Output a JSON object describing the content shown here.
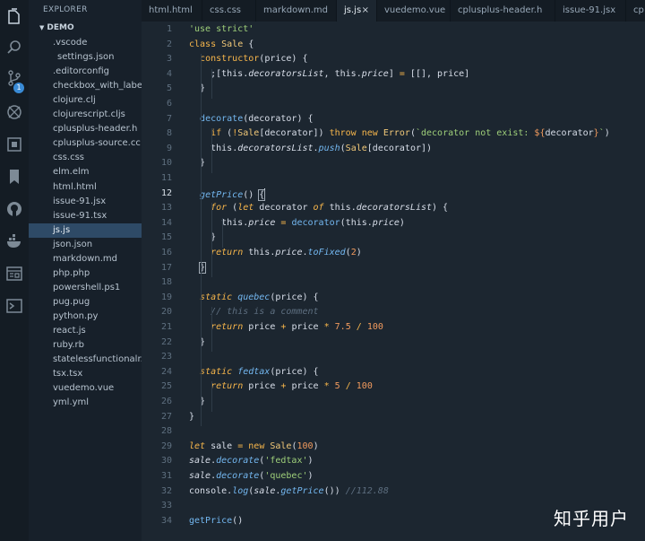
{
  "explorer": {
    "title": "EXPLORER",
    "folder": "DEMO",
    "files": [
      ".vscode",
      "settings.json",
      ".editorconfig",
      "checkbox_with_label...",
      "clojure.clj",
      "clojurescript.cljs",
      "cplusplus-header.h",
      "cplusplus-source.cc",
      "css.css",
      "elm.elm",
      "html.html",
      "issue-91.jsx",
      "issue-91.tsx",
      "js.js",
      "json.json",
      "markdown.md",
      "php.php",
      "powershell.ps1",
      "pug.pug",
      "python.py",
      "react.js",
      "ruby.rb",
      "statelessfunctionalr...",
      "tsx.tsx",
      "vuedemo.vue",
      "yml.yml"
    ]
  },
  "activity": {
    "icons": [
      "files-icon",
      "search-icon",
      "source-control-icon",
      "debug-icon",
      "extensions-icon",
      "bookmark-icon",
      "github-icon",
      "docker-icon",
      "browser-preview-icon",
      "terminal-icon"
    ],
    "scm_badge": "1",
    "color_icon": "#7d8a96"
  },
  "tabs": [
    "html.html",
    "css.css",
    "markdown.md",
    "js.js",
    "vuedemo.vue",
    "cplusplus-header.h",
    "issue-91.jsx",
    "cp"
  ],
  "active_tab_close": "×",
  "editor": {
    "current_line": 12,
    "line_numbers": [
      "1",
      "2",
      "3",
      "4",
      "5",
      "6",
      "7",
      "8",
      "9",
      "10",
      "11",
      "12",
      "13",
      "14",
      "15",
      "16",
      "17",
      "18",
      "19",
      "20",
      "21",
      "22",
      "23",
      "24",
      "25",
      "26",
      "27",
      "28",
      "29",
      "30",
      "31",
      "32",
      "33",
      "34"
    ],
    "lines": [
      "'use strict'",
      "class Sale {",
      "  constructor(price) {",
      "    ;[this.decoratorsList, this.price] = [[], price]",
      "  }",
      "",
      "  decorate(decorator) {",
      "    if (!Sale[decorator]) throw new Error(`decorator not exist: ${decorator}`)",
      "    this.decoratorsList.push(Sale[decorator])",
      "  }",
      "",
      "  getPrice() {",
      "    for (let decorator of this.decoratorsList) {",
      "      this.price = decorator(this.price)",
      "    }",
      "    return this.price.toFixed(2)",
      "  }",
      "",
      "  static quebec(price) {",
      "    // this is a comment",
      "    return price + price * 7.5 / 100",
      "  }",
      "",
      "  static fedtax(price) {",
      "    return price + price * 5 / 100",
      "  }",
      "}",
      "",
      "let sale = new Sale(100)",
      "sale.decorate('fedtax')",
      "sale.decorate('quebec')",
      "console.log(sale.getPrice()) //112.88",
      "",
      "getPrice()"
    ],
    "colors": {
      "keyword": "#f7b64b",
      "string": "#9fd07a",
      "number": "#f29b5e",
      "function": "#73b7f0",
      "comment": "#5d6e7f",
      "text": "#d8dee9",
      "background": "#1c2630"
    }
  },
  "watermark": "知乎用户"
}
